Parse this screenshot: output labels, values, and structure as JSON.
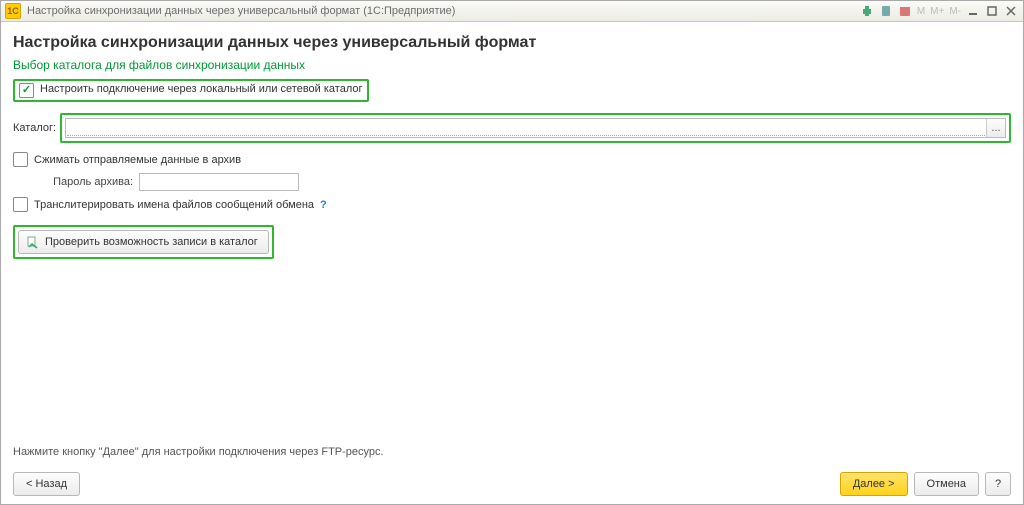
{
  "titlebar": {
    "app_logo_text": "1C",
    "title": "Настройка синхронизации данных через универсальный формат  (1С:Предприятие)",
    "m_labels": [
      "M",
      "M+",
      "M-"
    ]
  },
  "header": {
    "title": "Настройка синхронизации данных через универсальный формат",
    "subtitle": "Выбор каталога для файлов синхронизации данных"
  },
  "opts": {
    "use_local_label": "Настроить подключение через локальный или сетевой каталог",
    "catalog_label": "Каталог:",
    "catalog_value": "",
    "catalog_btn": "...",
    "archive_label": "Сжимать отправляемые данные в архив",
    "pass_label": "Пароль архива:",
    "pass_value": "",
    "pass_placeholder": "",
    "translit_label": "Транслитерировать имена файлов сообщений обмена",
    "help_char": "?",
    "check_btn_label": "Проверить возможность записи в каталог"
  },
  "hint": "Нажмите кнопку \"Далее\" для настройки подключения через FTP-ресурс.",
  "footer": {
    "back": "< Назад",
    "next": "Далее >",
    "cancel": "Отмена",
    "help": "?"
  }
}
